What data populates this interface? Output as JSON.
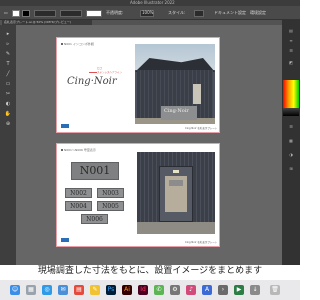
{
  "app": {
    "window_title": "Adobe Illustrator 2022"
  },
  "control_bar": {
    "opacity_label": "不透明度:",
    "opacity_value": "100%",
    "style_label": "スタイル:",
    "doc_setup": "ドキュメント設定",
    "prefs": "環境設定"
  },
  "tab": {
    "label": "名札表示プレート.ai @ 50% (CMYK/プレビュー)"
  },
  "artboard1": {
    "header": "N001 インコンポ外観",
    "logo": "Cing·Noir",
    "note1": "ロゴ",
    "note2": "ステンレスヘアライン",
    "sign_text": "Cing·Noir",
    "footer": "Cing Noir 名札表示プレート"
  },
  "artboard2": {
    "header": "N001〜N006 号室表示",
    "plates": [
      "N001",
      "N002",
      "N003",
      "N004",
      "N005",
      "N006"
    ],
    "footer": "Cing Noir 名札表示プレート"
  },
  "subtitle": "現場調査した寸法をもとに、設置イメージをまとめます",
  "tools": [
    "▸",
    "▹",
    "✎",
    "T",
    "╱",
    "▭",
    "✂",
    "◐",
    "✋",
    "⊕"
  ],
  "colors": {
    "artboard_border": "#e8a0a8",
    "footer_logo": "#2a6fb6",
    "plate": "#8f9092"
  },
  "dock_icons": [
    "finder-icon",
    "launchpad-icon",
    "safari-icon",
    "mail-icon",
    "photoshop-icon",
    "illustrator-icon",
    "indesign-icon",
    "trash-icon"
  ]
}
